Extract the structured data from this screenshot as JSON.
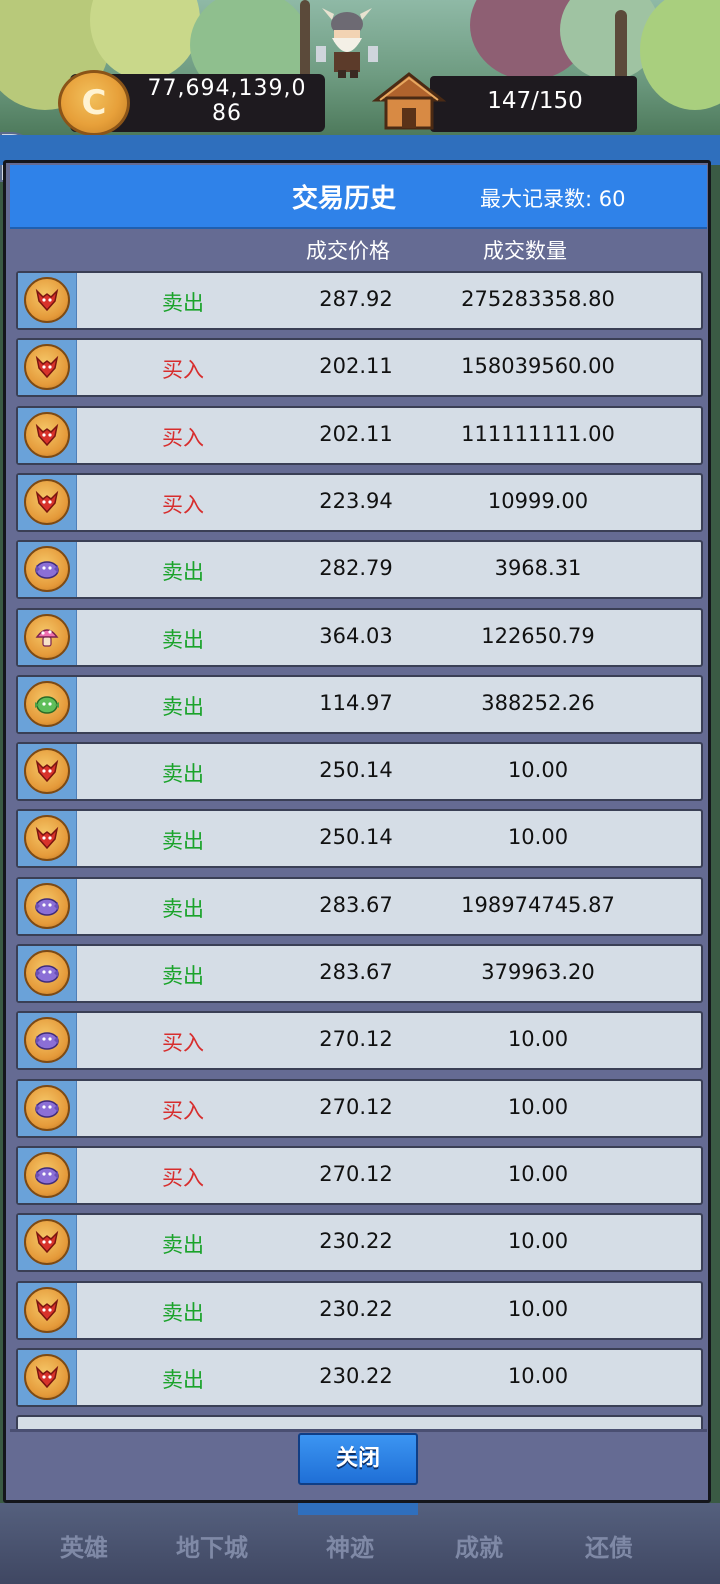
{
  "top_bar": {
    "gold": "77,694,139,0\n86",
    "gold_line1": "77,694,139,0",
    "gold_line2": "86",
    "population": "147/150",
    "coin_symbol": "C"
  },
  "modal": {
    "title": "交易历史",
    "max_records": "最大记录数: 60",
    "col_price": "成交价格",
    "col_qty": "成交数量",
    "close_label": "关闭",
    "sell_color": "#1aa32a",
    "buy_color": "#d72d2d",
    "rows": [
      {
        "icon": "dragon-token-icon",
        "action": "卖出",
        "type": "sell",
        "price": "287.92",
        "qty": "275283358.80"
      },
      {
        "icon": "dragon-token-icon",
        "action": "买入",
        "type": "buy",
        "price": "202.11",
        "qty": "158039560.00"
      },
      {
        "icon": "dragon-token-icon",
        "action": "买入",
        "type": "buy",
        "price": "202.11",
        "qty": "111111111.00"
      },
      {
        "icon": "dragon-token-icon",
        "action": "买入",
        "type": "buy",
        "price": "223.94",
        "qty": "10999.00"
      },
      {
        "icon": "purple-fish-token-icon",
        "action": "卖出",
        "type": "sell",
        "price": "282.79",
        "qty": "3968.31"
      },
      {
        "icon": "mushroom-token-icon",
        "action": "卖出",
        "type": "sell",
        "price": "364.03",
        "qty": "122650.79"
      },
      {
        "icon": "goblin-token-icon",
        "action": "卖出",
        "type": "sell",
        "price": "114.97",
        "qty": "388252.26"
      },
      {
        "icon": "dragon-token-icon",
        "action": "卖出",
        "type": "sell",
        "price": "250.14",
        "qty": "10.00"
      },
      {
        "icon": "dragon-token-icon",
        "action": "卖出",
        "type": "sell",
        "price": "250.14",
        "qty": "10.00"
      },
      {
        "icon": "purple-fish-token-icon",
        "action": "卖出",
        "type": "sell",
        "price": "283.67",
        "qty": "198974745.87"
      },
      {
        "icon": "purple-fish-token-icon",
        "action": "卖出",
        "type": "sell",
        "price": "283.67",
        "qty": "379963.20"
      },
      {
        "icon": "purple-fish-token-icon",
        "action": "买入",
        "type": "buy",
        "price": "270.12",
        "qty": "10.00"
      },
      {
        "icon": "purple-fish-token-icon",
        "action": "买入",
        "type": "buy",
        "price": "270.12",
        "qty": "10.00"
      },
      {
        "icon": "purple-fish-token-icon",
        "action": "买入",
        "type": "buy",
        "price": "270.12",
        "qty": "10.00"
      },
      {
        "icon": "dragon-token-icon",
        "action": "卖出",
        "type": "sell",
        "price": "230.22",
        "qty": "10.00"
      },
      {
        "icon": "dragon-token-icon",
        "action": "卖出",
        "type": "sell",
        "price": "230.22",
        "qty": "10.00"
      },
      {
        "icon": "dragon-token-icon",
        "action": "卖出",
        "type": "sell",
        "price": "230.22",
        "qty": "10.00"
      }
    ]
  },
  "bottom_nav": {
    "items": [
      "英雄",
      "地下城",
      "神迹",
      "成就",
      "还债"
    ]
  }
}
